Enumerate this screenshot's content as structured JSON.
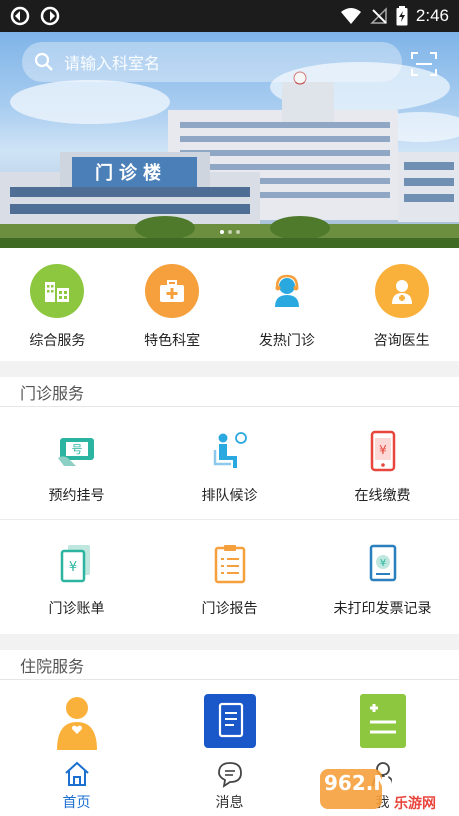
{
  "status_bar": {
    "time": "2:46"
  },
  "search": {
    "placeholder": "请输入科室名"
  },
  "quick_services": [
    {
      "label": "综合服务",
      "color": "#8dc63f"
    },
    {
      "label": "特色科室",
      "color": "#f5a03c"
    },
    {
      "label": "发热门诊",
      "color": "#2aa8e0"
    },
    {
      "label": "咨询医生",
      "color": "#f9b13c"
    }
  ],
  "outpatient": {
    "title": "门诊服务",
    "items": [
      {
        "label": "预约挂号"
      },
      {
        "label": "排队候诊"
      },
      {
        "label": "在线缴费"
      },
      {
        "label": "门诊账单"
      },
      {
        "label": "门诊报告"
      },
      {
        "label": "未打印发票记录"
      }
    ]
  },
  "inpatient": {
    "title": "住院服务"
  },
  "hospital_sign": "门诊楼",
  "bottom_nav": [
    {
      "label": "首页"
    },
    {
      "label": "消息"
    },
    {
      "label": "我"
    }
  ],
  "watermark": {
    "brand": "962.NET",
    "sub": "乐游网"
  },
  "colors": {
    "accent": "#1a6fd1",
    "teal": "#2bb5a0",
    "orange": "#f5a03c",
    "red": "#e8453c"
  }
}
